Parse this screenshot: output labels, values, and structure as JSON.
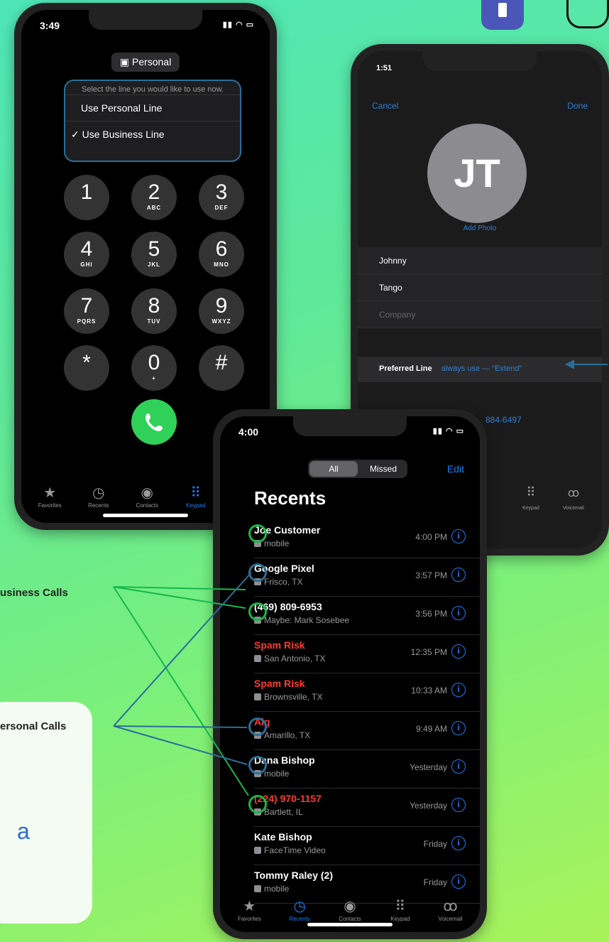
{
  "keypad_phone": {
    "time": "3:49",
    "pill": "Personal",
    "menu_prompt": "Select the line you would like to use now.",
    "menu_items": [
      "Use Personal Line",
      "Use Business Line"
    ],
    "selected_mark": "✓",
    "keys": [
      {
        "d": "1",
        "l": ""
      },
      {
        "d": "2",
        "l": "ABC"
      },
      {
        "d": "3",
        "l": "DEF"
      },
      {
        "d": "4",
        "l": "GHI"
      },
      {
        "d": "5",
        "l": "JKL"
      },
      {
        "d": "6",
        "l": "MNO"
      },
      {
        "d": "7",
        "l": "PQRS"
      },
      {
        "d": "8",
        "l": "TUV"
      },
      {
        "d": "9",
        "l": "WXYZ"
      },
      {
        "d": "*",
        "l": ""
      },
      {
        "d": "0",
        "l": "+"
      },
      {
        "d": "#",
        "l": ""
      }
    ],
    "tabs": [
      "Favorites",
      "Recents",
      "Contacts",
      "Keypad"
    ]
  },
  "contact_phone": {
    "time": "1:51",
    "cancel": "Cancel",
    "done": "Done",
    "initials": "JT",
    "add_photo": "Add Photo",
    "first_name": "Johnny",
    "last_name": "Tango",
    "company": "Company",
    "preferred_label": "Preferred Line",
    "preferred_value": "always use — \"Extend\"",
    "phone_partial": "884-6497",
    "tabs": [
      "Keypad",
      "Voicemail"
    ]
  },
  "recents_phone": {
    "time": "4:00",
    "segments": [
      "All",
      "Missed"
    ],
    "edit": "Edit",
    "title": "Recents",
    "rows": [
      {
        "name": "Joe Customer",
        "sub": "mobile",
        "time": "4:00 PM",
        "red": false
      },
      {
        "name": "Google Pixel",
        "sub": "Frisco, TX",
        "time": "3:57 PM",
        "red": false
      },
      {
        "name": "(469) 809-6953",
        "sub": "Maybe: Mark Sosebee",
        "time": "3:56 PM",
        "red": false
      },
      {
        "name": "Spam Risk",
        "sub": "San Antonio, TX",
        "time": "12:35 PM",
        "red": true
      },
      {
        "name": "Spam Risk",
        "sub": "Brownsville, TX",
        "time": "10:33 AM",
        "red": true
      },
      {
        "name": "Aig",
        "sub": "Amarillo, TX",
        "time": "9:49 AM",
        "red": true
      },
      {
        "name": "Dana Bishop",
        "sub": "mobile",
        "time": "Yesterday",
        "red": false
      },
      {
        "name": "(224) 970-1157",
        "sub": "Bartlett, IL",
        "time": "Yesterday",
        "red": true
      },
      {
        "name": "Kate Bishop",
        "sub": "FaceTime Video",
        "time": "Friday",
        "red": false
      },
      {
        "name": "Tommy Raley (2)",
        "sub": "mobile",
        "time": "Friday",
        "red": false
      }
    ],
    "tabs": [
      "Favorites",
      "Recents",
      "Contacts",
      "Keypad",
      "Voicemail"
    ]
  },
  "callouts": {
    "business": "usiness Calls",
    "personal": "ersonal Calls"
  },
  "card_letter": "a",
  "colors": {
    "green_marker": "#16b84a",
    "blue_marker": "#2b6f98",
    "ios_blue": "#1e7cf2",
    "spam_red": "#ff3b30"
  }
}
